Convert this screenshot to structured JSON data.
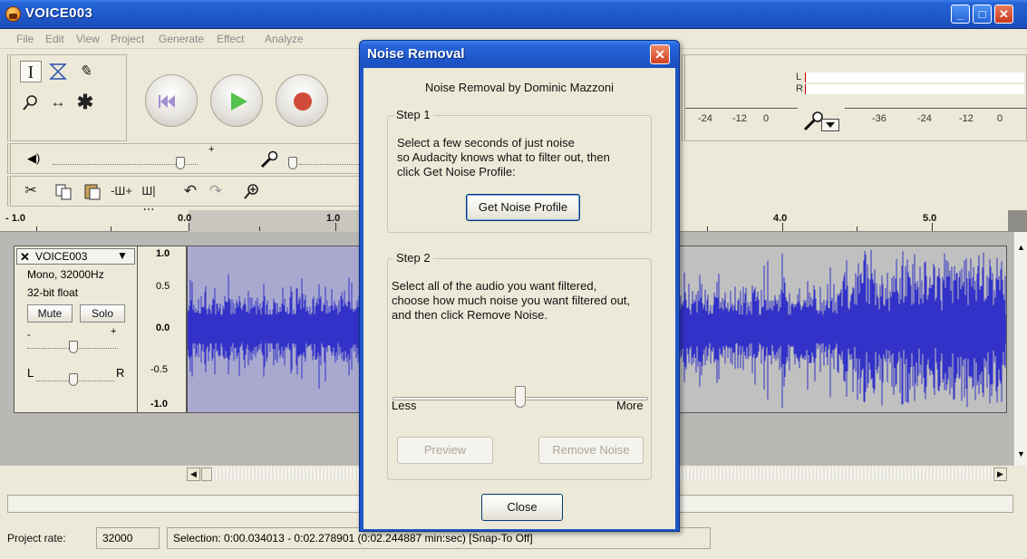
{
  "window": {
    "title": "VOICE003",
    "min_glyph": "_",
    "max_glyph": "□",
    "close_glyph": "✕"
  },
  "menu": [
    "File",
    "Edit",
    "View",
    "Project",
    "Generate",
    "Effect",
    "Analyze"
  ],
  "meters": {
    "left_channel": "L",
    "right_channel": "R",
    "play_scale": [
      "-24",
      "-12",
      "0"
    ],
    "record_scale": [
      "-36",
      "-24",
      "-12",
      "0"
    ]
  },
  "ruler": {
    "labels": [
      "- 1.0",
      "0.0",
      "1.0",
      "4.0",
      "5.0"
    ]
  },
  "track": {
    "name": "VOICE003",
    "format": "Mono, 32000Hz",
    "sample_format": "32-bit float",
    "mute_label": "Mute",
    "solo_label": "Solo",
    "gain_minus": "-",
    "gain_plus": "+",
    "pan_left": "L",
    "pan_right": "R",
    "scale": [
      "1.0",
      "0.5",
      "0.0",
      "-0.5",
      "-1.0"
    ]
  },
  "status": {
    "project_rate_label": "Project rate:",
    "project_rate_value": "32000",
    "selection_text": "Selection: 0:00.034013 - 0:02.278901 (0:02.244887 min:sec)  [Snap-To Off]"
  },
  "dialog": {
    "title": "Noise Removal",
    "close_glyph": "✕",
    "credit": "Noise Removal by Dominic Mazzoni",
    "step1_label": "Step 1",
    "step1_line1": "Select a few seconds of just noise",
    "step1_line2": "so Audacity knows what to filter out, then",
    "step1_line3": "click Get Noise Profile:",
    "get_profile_label": "Get Noise Profile",
    "step2_label": "Step 2",
    "step2_line1": "Select all of the audio you want filtered,",
    "step2_line2": "choose how much noise you want filtered out,",
    "step2_line3": "and then click Remove Noise.",
    "slider_level": 0.5,
    "less_label": "Less",
    "more_label": "More",
    "preview_label": "Preview",
    "remove_label": "Remove Noise",
    "close_label": "Close"
  },
  "colors": {
    "titlebar": "#1f57c8",
    "waveform": "#3232c8",
    "selection": "#ffffff",
    "chrome": "#ece9d8"
  }
}
